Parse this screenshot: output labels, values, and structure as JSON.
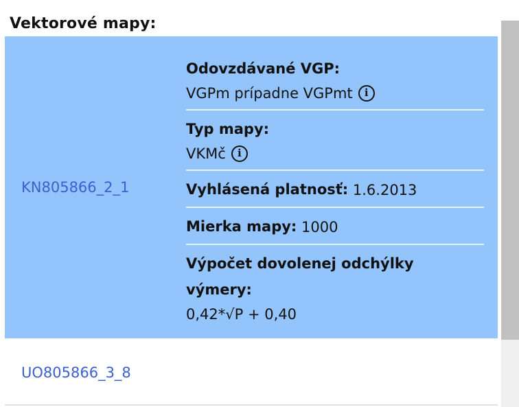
{
  "section": {
    "title": "Vektorové mapy:"
  },
  "rows": [
    {
      "link": "KN805866_2_1",
      "selected": true,
      "details": {
        "vgp_label": "Odovzdávané VGP:",
        "vgp_value": "VGPm prípadne VGPmt",
        "map_type_label": "Typ mapy:",
        "map_type_value": "VKMč",
        "validity_label": "Vyhlásená platnosť:",
        "validity_value": "1.6.2013",
        "scale_label": "Mierka mapy:",
        "scale_value": "1000",
        "deviation_label": "Výpočet dovolenej odchýlky výmery:",
        "deviation_value": "0,42*√P + 0,40"
      }
    },
    {
      "link": "UO805866_3_8",
      "selected": false
    }
  ],
  "icons": {
    "info": "info-circle-icon",
    "info_glyph": "i"
  },
  "colors": {
    "selected_row": "#93c4fb",
    "link": "#3b5fd1",
    "scrollbar_thumb": "#c1c1c1"
  }
}
